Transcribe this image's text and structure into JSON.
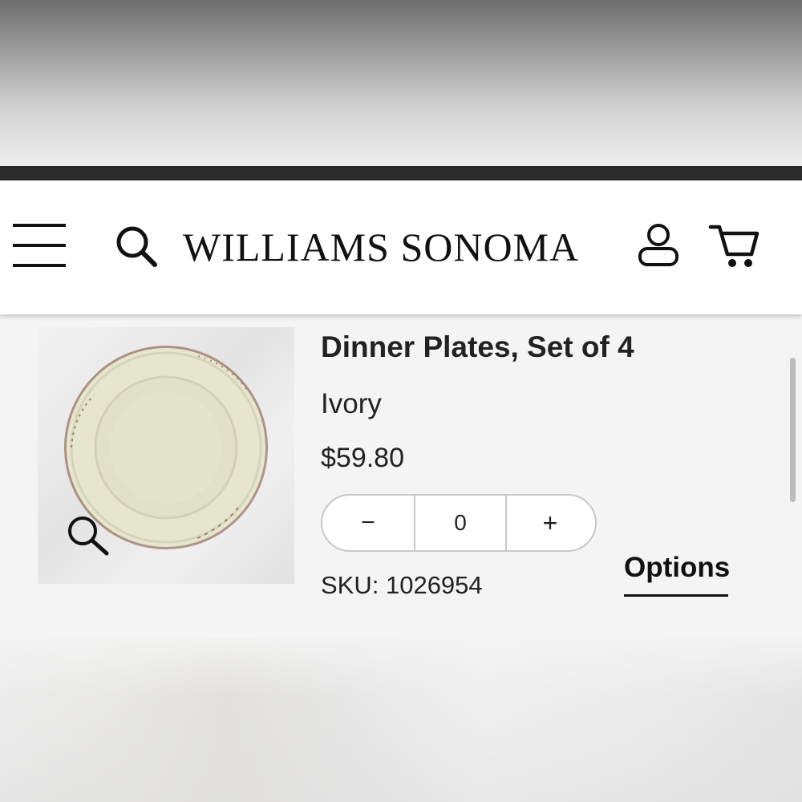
{
  "header": {
    "brand": "WILLIAMS SONOMA",
    "icons": [
      "menu-icon",
      "search-icon",
      "account-icon",
      "cart-icon"
    ]
  },
  "product": {
    "title": "Dinner Plates, Set of 4",
    "color": "Ivory",
    "price": "$59.80",
    "quantity": {
      "decrement": "−",
      "value": "0",
      "increment": "+"
    },
    "sku": "SKU: 1026954",
    "options_label": "Options"
  },
  "colors": {
    "text": "#222222",
    "header_bg": "#ffffff",
    "card_bg": "#f4f4f4",
    "status_bar": "#2b2b2b",
    "plate_ivory": "#e6e6cf",
    "plate_edge": "#7a4a32"
  }
}
